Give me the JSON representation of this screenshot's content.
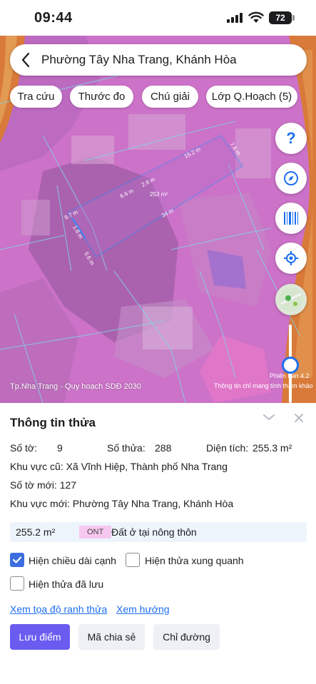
{
  "status_bar": {
    "time": "09:44",
    "battery": "72"
  },
  "search": {
    "title": "Phường Tây Nha Trang, Khánh Hòa"
  },
  "chips": [
    {
      "label": "Tra cứu"
    },
    {
      "label": "Thước đo"
    },
    {
      "label": "Chú giải"
    },
    {
      "label": "Lớp Q.Hoạch (5)"
    }
  ],
  "map": {
    "plan_label": "Tp.Nha Trang - Quy hoạch SDĐ 2030",
    "version": "Phiên bản 4.2",
    "note": "Thông tin chỉ mang tính tham khảo",
    "parcel_area": "253 m²",
    "edges": [
      "15.2 m",
      "7.6 m",
      "34 m",
      "5.6 m",
      "1.8 m",
      "9.7 m",
      "6.6 m",
      "2.8 m"
    ]
  },
  "panel": {
    "title": "Thông tin thửa",
    "to_label": "Số tờ:",
    "to_value": "9",
    "thua_label": "Số thửa:",
    "thua_value": "288",
    "area_label": "Diện tích:",
    "area_value": "255.3 m²",
    "old_area": "Khu vực cũ: Xã Vĩnh Hiệp, Thành phố Nha Trang",
    "new_sheet": "Số tờ mới: 127",
    "new_area": "Khu vực mới: Phường Tây Nha Trang, Khánh Hòa",
    "usage_area": "255.2 m²",
    "usage_code": "ONT",
    "usage_desc": "Đất ở tại nông thôn",
    "checkboxes": [
      {
        "label": "Hiện chiều dài cạnh",
        "checked": true
      },
      {
        "label": "Hiện thửa xung quanh",
        "checked": false
      },
      {
        "label": "Hiện thửa đã lưu",
        "checked": false
      }
    ],
    "links": [
      "Xem tọa độ ranh thửa",
      "Xem hướng"
    ],
    "buttons": [
      "Lưu điểm",
      "Mã chia sẻ",
      "Chỉ đường"
    ]
  },
  "colors": {
    "accent": "#1e6ff0",
    "primary_button": "#6a5cf0",
    "map_pink": "#d873d2",
    "map_orange": "#d97a3a"
  }
}
